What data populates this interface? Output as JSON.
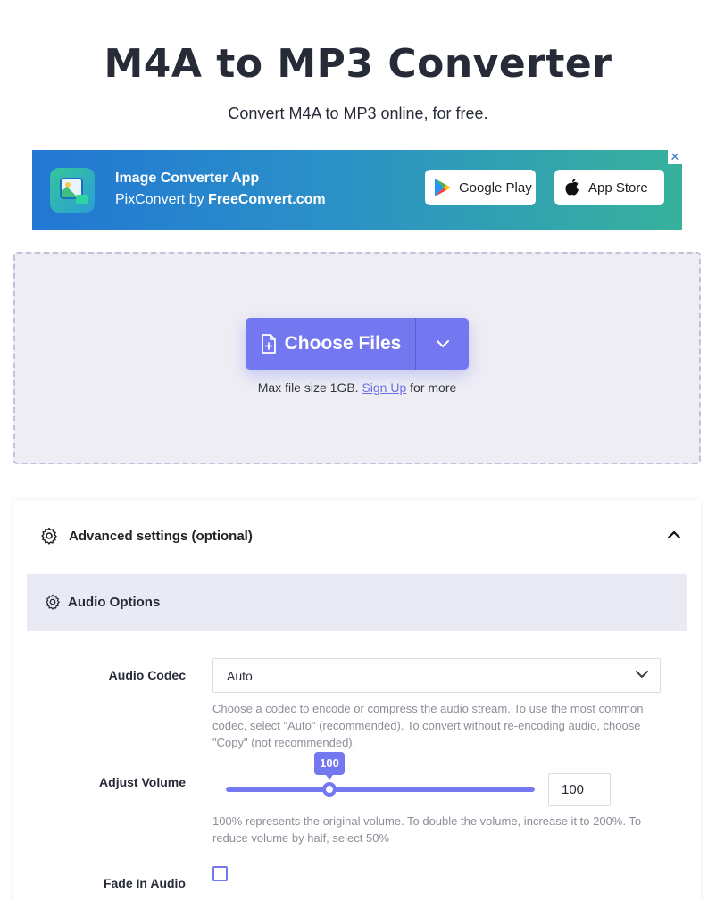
{
  "page": {
    "title": "M4A to MP3 Converter",
    "subtitle": "Convert M4A to MP3 online, for free."
  },
  "ad": {
    "title": "Image Converter App",
    "subtitle_prefix": "PixConvert by ",
    "subtitle_brand": "FreeConvert.com",
    "google_play_label": "Google Play",
    "app_store_label": "App Store",
    "close_label": "✕"
  },
  "upload": {
    "choose_files_label": "Choose Files",
    "max_size_prefix": "Max file size 1GB. ",
    "sign_up_label": "Sign Up",
    "max_size_suffix": " for more"
  },
  "advanced": {
    "header_label": "Advanced settings (optional)",
    "expanded": true,
    "section_title": "Audio Options",
    "audio_codec": {
      "label": "Audio Codec",
      "value": "Auto",
      "help": "Choose a codec to encode or compress the audio stream. To use the most common codec, select \"Auto\" (recommended). To convert without re-encoding audio, choose \"Copy\" (not recommended)."
    },
    "adjust_volume": {
      "label": "Adjust Volume",
      "slider_value": "100",
      "input_value": "100",
      "help": "100% represents the original volume. To double the volume, increase it to 200%. To reduce volume by half, select 50%"
    },
    "fade_in_audio": {
      "label": "Fade In Audio",
      "checked": false
    }
  },
  "colors": {
    "accent": "#7378f1",
    "text": "#272b37",
    "muted": "#8c8f99",
    "dropzone_bg": "#eeedf4"
  }
}
